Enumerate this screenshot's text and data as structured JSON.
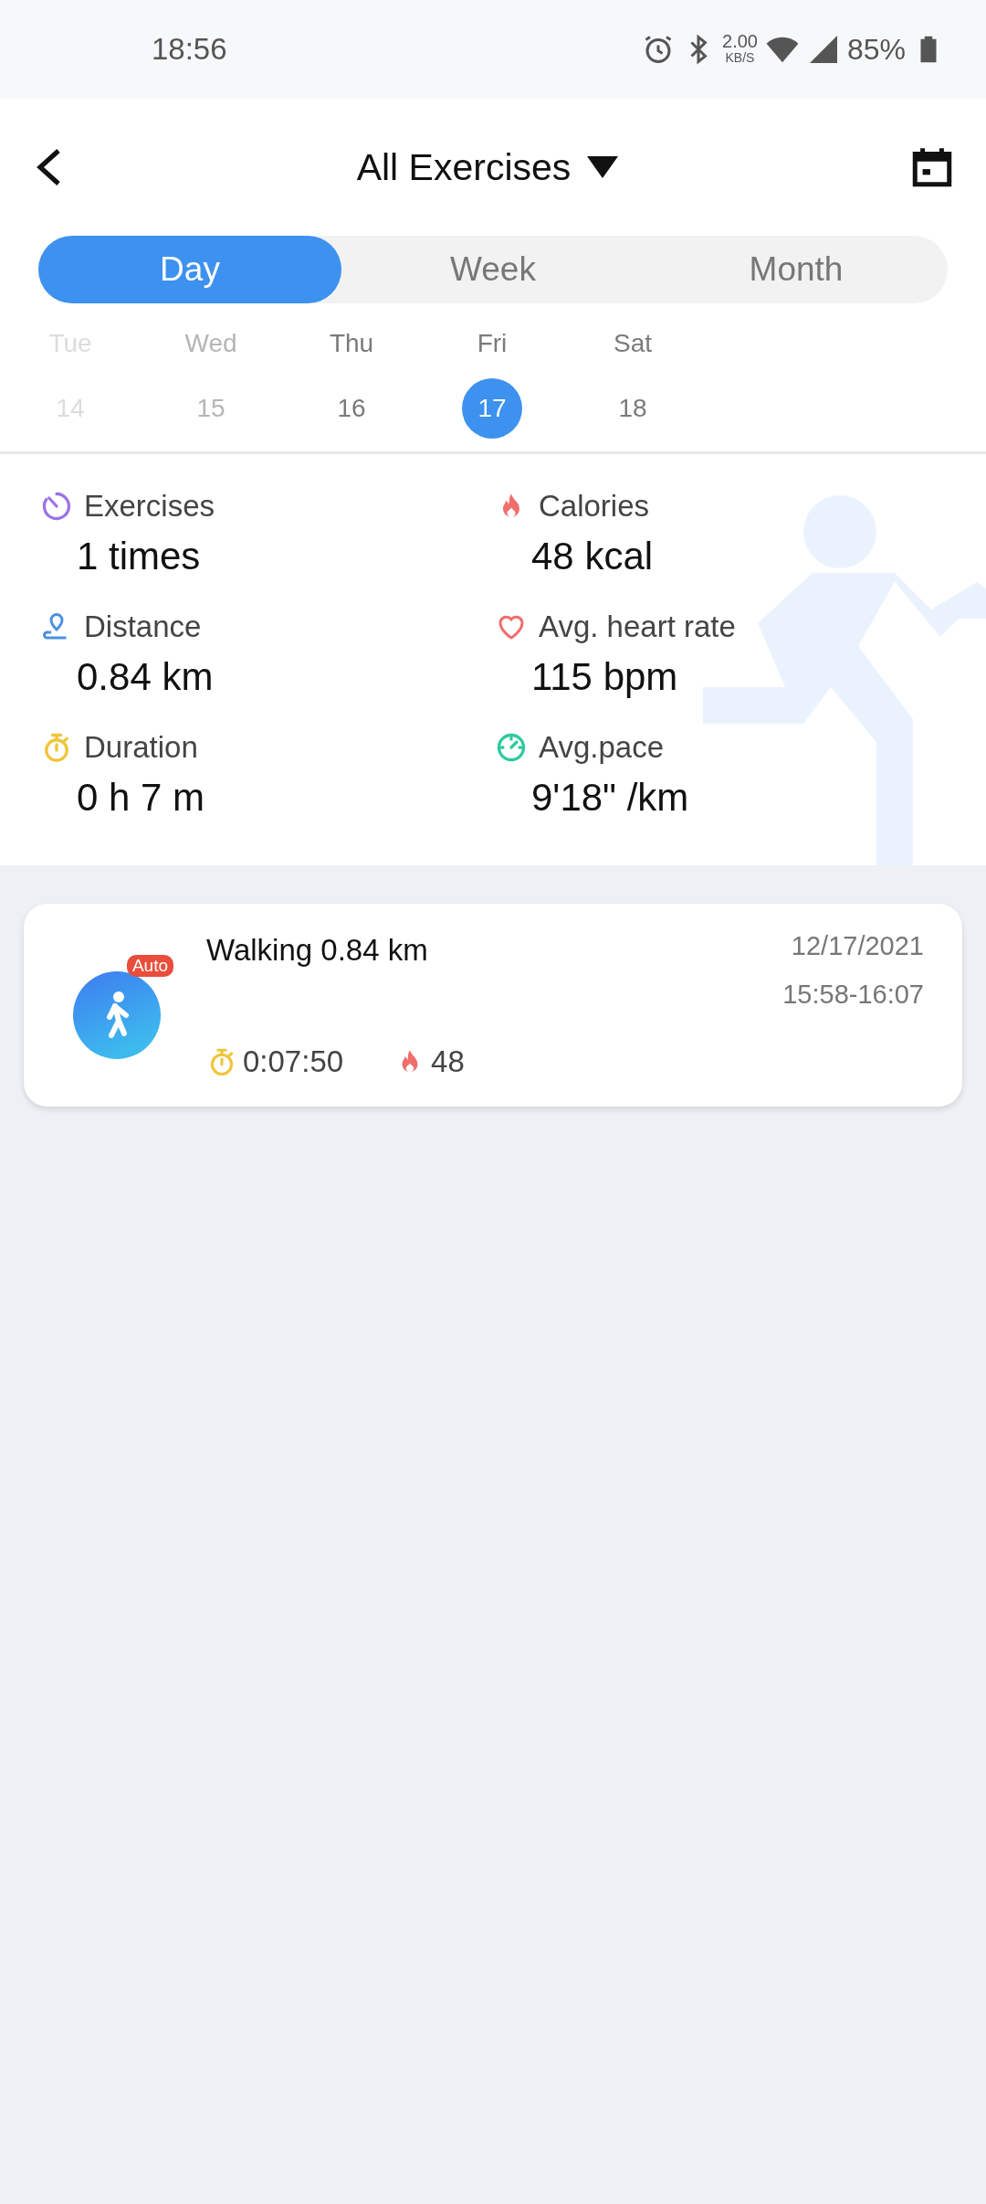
{
  "status_bar": {
    "time": "18:56",
    "speed": "2.00",
    "speed_unit": "KB/S",
    "battery": "85%"
  },
  "header": {
    "title": "All Exercises"
  },
  "tabs": [
    {
      "label": "Day",
      "selected": true
    },
    {
      "label": "Week",
      "selected": false
    },
    {
      "label": "Month",
      "selected": false
    }
  ],
  "days": [
    {
      "weekday": "Tue",
      "date": "14",
      "kind": "faint",
      "selected": false
    },
    {
      "weekday": "Wed",
      "date": "15",
      "kind": "light",
      "selected": false
    },
    {
      "weekday": "Thu",
      "date": "16",
      "kind": "normal",
      "selected": false
    },
    {
      "weekday": "Fri",
      "date": "17",
      "kind": "normal",
      "selected": true
    },
    {
      "weekday": "Sat",
      "date": "18",
      "kind": "normal",
      "selected": false
    }
  ],
  "stats": [
    {
      "kind": "exercises",
      "label": "Exercises",
      "value": "1 times"
    },
    {
      "kind": "calories",
      "label": "Calories",
      "value": "48 kcal"
    },
    {
      "kind": "distance",
      "label": "Distance",
      "value": "0.84 km"
    },
    {
      "kind": "heart",
      "label": "Avg. heart rate",
      "value": "115 bpm"
    },
    {
      "kind": "duration",
      "label": "Duration",
      "value": "0 h 7 m"
    },
    {
      "kind": "pace",
      "label": "Avg.pace",
      "value": "9'18\" /km"
    }
  ],
  "records": [
    {
      "badge": "Auto",
      "title": "Walking 0.84 km",
      "date": "12/17/2021",
      "time_range": "15:58-16:07",
      "duration": "0:07:50",
      "calories": "48"
    }
  ]
}
